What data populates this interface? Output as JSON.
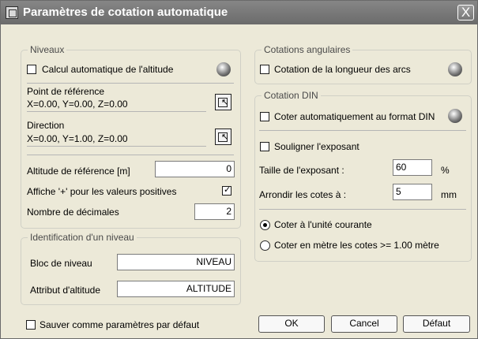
{
  "window": {
    "title": "Paramètres de cotation automatique",
    "close": "X"
  },
  "niveaux": {
    "legend": "Niveaux",
    "calc_alt": "Calcul automatique de l'altitude",
    "point_ref": "Point de référence",
    "point_ref_value": "X=0.00, Y=0.00, Z=0.00",
    "direction": "Direction",
    "direction_value": "X=0.00, Y=1.00, Z=0.00",
    "altitude_ref_label": "Altitude de référence [m]",
    "altitude_ref_value": "0",
    "show_plus": "Affiche '+' pour les valeurs positives",
    "decimals_label": "Nombre de décimales",
    "decimals_value": "2"
  },
  "identification": {
    "legend": "Identification d'un niveau",
    "block_label": "Bloc de niveau",
    "block_value": "NIVEAU",
    "attr_label": "Attribut d'altitude",
    "attr_value": "ALTITUDE"
  },
  "angulaires": {
    "legend": "Cotations angulaires",
    "length_arcs": "Cotation de la longueur des arcs"
  },
  "din": {
    "legend": "Cotation DIN",
    "auto_din": "Coter automatiquement au format DIN",
    "underline_exp": "Souligner l'exposant",
    "exp_size_label": "Taille de l'exposant :",
    "exp_size_value": "60",
    "exp_size_unit": "%",
    "round_label": "Arrondir les cotes à :",
    "round_value": "5",
    "round_unit": "mm",
    "radio_current": "Coter à l'unité courante",
    "radio_meter": "Coter en mètre les cotes >= 1.00 mètre"
  },
  "footer": {
    "save_default": "Sauver comme paramètres par défaut",
    "ok": "OK",
    "cancel": "Cancel",
    "default": "Défaut"
  }
}
